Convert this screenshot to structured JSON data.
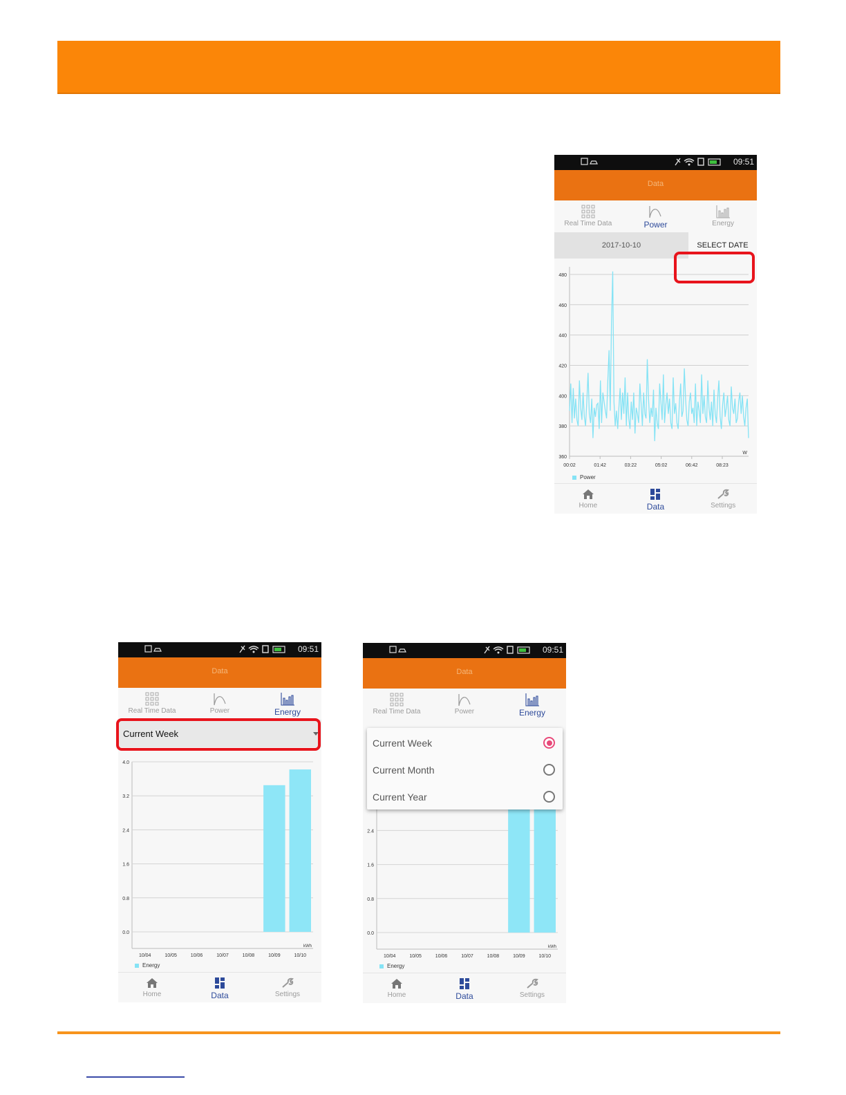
{
  "screens": {
    "power": {
      "status_time": "09:51",
      "appbar_title": "Data",
      "tabs": [
        {
          "label": "Real Time Data",
          "icon": "grid-icon"
        },
        {
          "label": "Power",
          "icon": "curve-icon"
        },
        {
          "label": "Energy",
          "icon": "bar-chart-icon"
        }
      ],
      "active_tab": 1,
      "date": "2017-10-10",
      "select_date": "SELECT DATE",
      "nav": [
        {
          "label": "Home",
          "icon": "home-icon"
        },
        {
          "label": "Data",
          "icon": "dashboard-icon"
        },
        {
          "label": "Settings",
          "icon": "wrench-icon"
        }
      ],
      "active_nav": 1
    },
    "energy_week": {
      "status_time": "09:51",
      "appbar_title": "Data",
      "tabs": [
        {
          "label": "Real Time Data",
          "icon": "grid-icon"
        },
        {
          "label": "Power",
          "icon": "curve-icon"
        },
        {
          "label": "Energy",
          "icon": "bar-chart-icon"
        }
      ],
      "active_tab": 2,
      "period": "Current Week",
      "nav": [
        {
          "label": "Home",
          "icon": "home-icon"
        },
        {
          "label": "Data",
          "icon": "dashboard-icon"
        },
        {
          "label": "Settings",
          "icon": "wrench-icon"
        }
      ],
      "active_nav": 1
    },
    "energy_dropdown": {
      "status_time": "09:51",
      "appbar_title": "Data",
      "tabs": [
        {
          "label": "Real Time Data",
          "icon": "grid-icon"
        },
        {
          "label": "Power",
          "icon": "curve-icon"
        },
        {
          "label": "Energy",
          "icon": "bar-chart-icon"
        }
      ],
      "active_tab": 2,
      "options": [
        {
          "label": "Current Week",
          "selected": true
        },
        {
          "label": "Current Month",
          "selected": false
        },
        {
          "label": "Current Year",
          "selected": false
        }
      ],
      "nav": [
        {
          "label": "Home",
          "icon": "home-icon"
        },
        {
          "label": "Data",
          "icon": "dashboard-icon"
        },
        {
          "label": "Settings",
          "icon": "wrench-icon"
        }
      ],
      "active_nav": 1
    }
  },
  "colors": {
    "header_orange": "#fb8608",
    "appbar_orange": "#ea7212",
    "series_cyan": "#85e3f5",
    "active_blue": "#2d4a9a",
    "highlight_red": "#e8141c",
    "radio_pink": "#e84a7a"
  },
  "chart_data": [
    {
      "type": "line",
      "unit": "W",
      "legend": [
        "Power"
      ],
      "x_tick_labels": [
        "00:02",
        "01:42",
        "03:22",
        "05:02",
        "06:42",
        "08:23"
      ],
      "y_ticks": [
        360,
        380,
        400,
        420,
        440,
        460,
        480
      ],
      "ylim": [
        360,
        485
      ],
      "series": [
        {
          "name": "Power",
          "values": [
            390,
            408,
            382,
            405,
            385,
            398,
            384,
            380,
            410,
            392,
            384,
            402,
            386,
            380,
            396,
            415,
            388,
            382,
            398,
            372,
            392,
            386,
            394,
            395,
            378,
            410,
            382,
            402,
            396,
            390,
            385,
            410,
            430,
            390,
            448,
            482,
            396,
            380,
            390,
            378,
            392,
            405,
            384,
            402,
            388,
            412,
            380,
            402,
            385,
            378,
            396,
            384,
            402,
            375,
            392,
            388,
            382,
            408,
            395,
            380,
            402,
            388,
            385,
            424,
            398,
            382,
            392,
            386,
            404,
            370,
            392,
            382,
            378,
            408,
            396,
            384,
            414,
            382,
            394,
            402,
            388,
            398,
            382,
            378,
            412,
            388,
            395,
            382,
            378,
            396,
            408,
            386,
            390,
            418,
            398,
            384,
            380,
            396,
            402,
            388,
            392,
            382,
            408,
            380,
            396,
            390,
            382,
            414,
            388,
            400,
            386,
            382,
            410,
            392,
            384,
            396,
            380,
            404,
            388,
            382,
            398,
            410,
            386,
            378,
            394,
            402,
            386,
            392,
            400,
            384,
            380,
            406,
            392,
            388,
            398,
            382,
            385,
            396,
            402,
            388,
            400,
            386,
            380,
            392,
            398,
            372
          ]
        }
      ]
    },
    {
      "type": "bar",
      "unit": "kWh",
      "legend": [
        "Energy"
      ],
      "categories": [
        "10/04",
        "10/05",
        "10/06",
        "10/07",
        "10/08",
        "10/09",
        "10/10"
      ],
      "y_ticks": [
        "0.0",
        "0.8",
        "1.6",
        "2.4",
        "3.2",
        "4.0"
      ],
      "ylim": [
        0,
        4.0
      ],
      "series": [
        {
          "name": "Energy",
          "values": [
            0,
            0,
            0,
            0,
            0,
            3.45,
            3.82
          ]
        }
      ]
    },
    {
      "type": "bar",
      "unit": "kWh",
      "legend": [
        "Energy"
      ],
      "categories": [
        "10/04",
        "10/05",
        "10/06",
        "10/07",
        "10/08",
        "10/09",
        "10/10"
      ],
      "y_ticks": [
        "0.0",
        "0.8",
        "1.6",
        "2.4"
      ],
      "ylim": [
        0,
        4.0
      ],
      "series": [
        {
          "name": "Energy",
          "values": [
            0,
            0,
            0,
            0,
            0,
            3.45,
            3.82
          ]
        }
      ]
    }
  ]
}
